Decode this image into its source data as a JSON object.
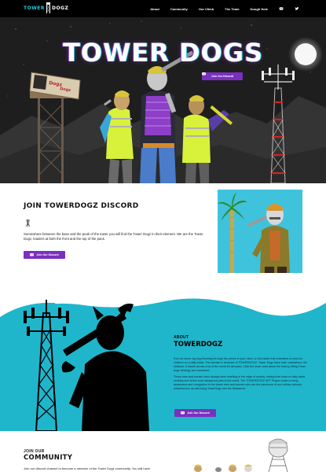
{
  "nav": {
    "logo_part1": "TOWER",
    "logo_part2": "DOGZ",
    "links": [
      "About",
      "Community",
      "Our Climb",
      "The Team",
      "Dough Hole"
    ],
    "icons": [
      "discord-icon",
      "twitter-icon"
    ]
  },
  "hero": {
    "title": "TOWER DOGS",
    "button_label": "Join Our Discord",
    "billboard_text": "Dogz Dogz"
  },
  "join": {
    "title": "JOIN TOWERDOGZ DISCORD",
    "text": "Somewhere between the base and the peak of the tower you will find the Tower Dogz in their element. We are the Tower Dogz, leaders at both the front and the top of the pack.",
    "button_label": "Join Our Discord"
  },
  "about": {
    "label": "ABOUT",
    "title": "TOWERDOGZ",
    "paragraph1": "Ever do some zig-zag-throwing through the phone in your hand, or that tablet that entertains us and our children on a daily basis. The domain is because of TOWERDOGZ. Tower Dogz have built, maintained, the Network, it hands across a lot of the world for decades. Click the lower area about the history, lifting Tower dogz strategy are connected.",
    "paragraph2": "These men and women have always been dwelling in the edge of society, risking their lives on daily basis working one of the most dangerous jobs in the world. The TOWERDOGZ NFT Project looks to bring awareness and recognition to the brave men and women who are the backbone of our cellular network infrastructure as well bring TowerDogz into the Metaverse.",
    "button_label": "Join Our Discord",
    "colors": {
      "teal": "#1fb6cc",
      "purple": "#7b2fbe"
    }
  },
  "community": {
    "label": "JOIN OUR",
    "title": "COMMUNITY",
    "text": "Join our discord channel to become a member of the Tower Dogz community. You will have"
  }
}
